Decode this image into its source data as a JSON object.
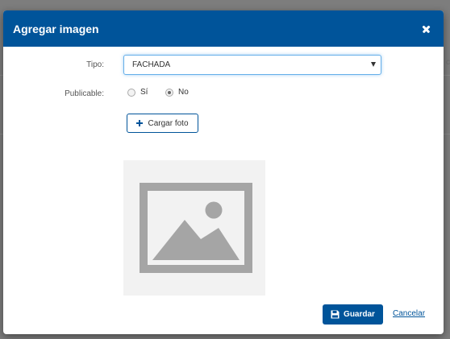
{
  "modal": {
    "title": "Agregar imagen",
    "close_label": "×"
  },
  "form": {
    "tipo_label": "Tipo:",
    "tipo_value": "FACHADA",
    "publicable_label": "Publicable:",
    "publicable_options": [
      {
        "label": "Sí",
        "checked": false
      },
      {
        "label": "No",
        "checked": true
      }
    ],
    "upload_button_label": "Cargar foto"
  },
  "footer": {
    "save_label": "Guardar",
    "cancel_label": "Cancelar"
  },
  "icons": {
    "close": "close-icon",
    "dropdown": "chevron-down-icon",
    "upload": "plus-icon",
    "image_placeholder": "image-icon",
    "save": "floppy-disk-icon"
  },
  "colors": {
    "header_bg": "#00549a",
    "primary": "#00549a",
    "overlay": "#7d7d7d",
    "placeholder_bg": "#f2f2f2",
    "placeholder_icon": "#a5a5a5"
  }
}
